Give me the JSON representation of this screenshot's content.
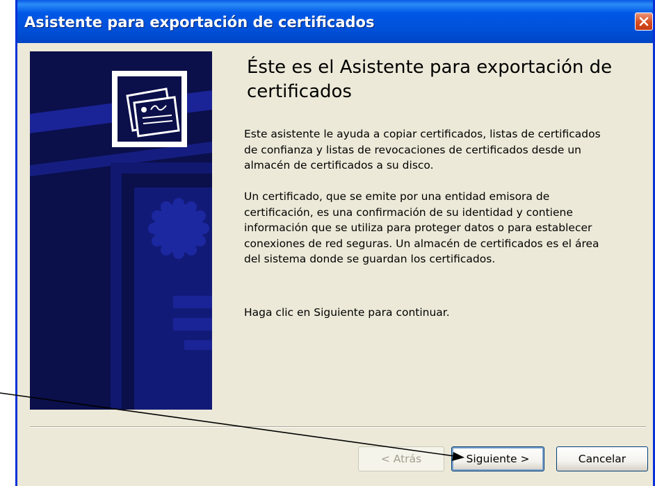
{
  "window": {
    "title": "Asistente para exportación de certificados"
  },
  "content": {
    "heading": "Éste es el Asistente para exportación de certificados",
    "paragraph_1": "Este asistente le ayuda a copiar certificados, listas de certificados de confianza y listas de revocaciones de certificados desde un almacén de certificados a su disco.",
    "paragraph_2": "Un certificado, que se emite por una entidad emisora de certificación, es una confirmación de su identidad y contiene información que se utiliza para proteger datos o para establecer conexiones de red seguras. Un almacén de certificados es el área del sistema donde se guardan los certificados.",
    "paragraph_3": "Haga clic en Siguiente para continuar."
  },
  "buttons": {
    "back_label": "< Atrás",
    "back_enabled": false,
    "next_label": "Siguiente >",
    "cancel_label": "Cancelar"
  },
  "icons": {
    "close": "close-icon",
    "certificate": "certificate-icon",
    "seal": "seal-icon"
  },
  "colors": {
    "title_bar": "#0054e3",
    "dialog_background": "#ece9d8",
    "banner_background": "#0b0f4a",
    "banner_stripe": "#1a2496",
    "close_button": "#d84b20"
  }
}
